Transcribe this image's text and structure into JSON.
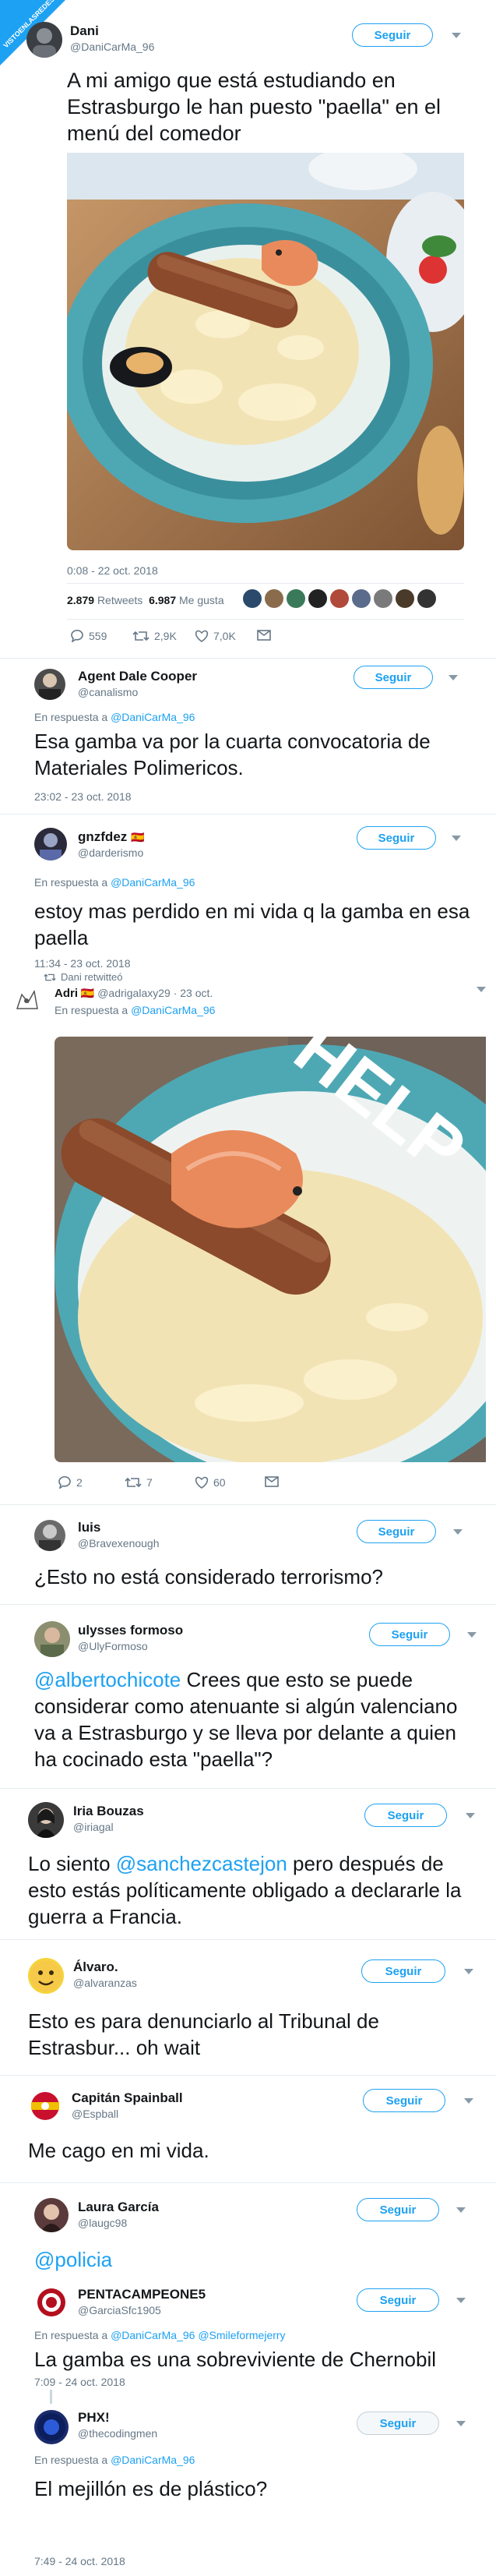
{
  "watermark": "VISTOENLASREDES.COM",
  "main_tweet": {
    "name": "Dani",
    "handle": "@DaniCarMa_96",
    "follow": "Seguir",
    "text": "A mi amigo que está estudiando en Estrasburgo le han puesto \"paella\" en el menú del comedor",
    "time": "0:08 - 22 oct. 2018",
    "retweets_count": "2.879",
    "retweets_label": "Retweets",
    "likes_count": "6.987",
    "likes_label": "Me gusta",
    "reply_count": "559",
    "rt_count": "2,9K",
    "like_count": "7,0K"
  },
  "replies": [
    {
      "name": "Agent Dale Cooper",
      "handle": "@canalismo",
      "follow": "Seguir",
      "reply_to_prefix": "En respuesta a",
      "reply_to": "@DaniCarMa_96",
      "text": "Esa gamba va por la cuarta convocatoria de Materiales Polimericos.",
      "time": "23:02 - 23 oct. 2018"
    },
    {
      "name": "gnzfdez",
      "flag": "🇪🇸",
      "handle": "@darderismo",
      "follow": "Seguir",
      "reply_to_prefix": "En respuesta a",
      "reply_to": "@DaniCarMa_96",
      "text": "estoy mas perdido en mi vida q la gamba en esa paella",
      "time": "11:34 - 23 oct. 2018"
    }
  ],
  "retweet": {
    "retweeted_by": "Dani retwitteó",
    "name": "Adri",
    "flag": "🇪🇸",
    "handle": "@adrigalaxy29",
    "date": "· 23 oct.",
    "reply_to_prefix": "En respuesta a",
    "reply_to": "@DaniCarMa_96",
    "image_text": "HELP",
    "reply_count": "2",
    "rt_count": "7",
    "like_count": "60"
  },
  "replies2": [
    {
      "name": "luis",
      "handle": "@Bravexenough",
      "follow": "Seguir",
      "text": "¿Esto no está considerado terrorismo?"
    },
    {
      "name": "ulysses formoso",
      "handle": "@UlyFormoso",
      "follow": "Seguir",
      "mention": "@albertochicote",
      "text": " Crees que esto se puede considerar como atenuante si algún valenciano va a Estrasburgo y se lleva por delante a quien ha cocinado esta \"paella\"?"
    },
    {
      "name": "Iria Bouzas",
      "handle": "@iriagal",
      "follow": "Seguir",
      "text_a": "Lo siento ",
      "mention": "@sanchezcastejon",
      "text_b": " pero después de esto estás políticamente obligado a declararle la guerra a Francia."
    },
    {
      "name": "Álvaro.",
      "handle": "@alvaranzas",
      "follow": "Seguir",
      "text": "Esto es para denunciarlo al Tribunal de Estrasbur... oh wait"
    },
    {
      "name": "Capitán Spainball",
      "handle": "@Espball",
      "follow": "Seguir",
      "text": "Me cago en mi vida."
    },
    {
      "name": "Laura García",
      "handle": "@laugc98",
      "follow": "Seguir",
      "mention": "@policia"
    },
    {
      "name": "PENTACAMPEONE5",
      "handle": "@GarciaSfc1905",
      "follow": "Seguir",
      "reply_to_prefix": "En respuesta a",
      "reply_to": "@DaniCarMa_96 @Smileformejerry",
      "text": "La gamba es una sobreviviente de Chernobil",
      "time": "7:09 - 24 oct. 2018"
    },
    {
      "name": "PHX!",
      "handle": "@thecodingmen",
      "follow": "Seguir",
      "reply_to_prefix": "En respuesta a",
      "reply_to": "@DaniCarMa_96",
      "text": "El mejillón es de plástico?",
      "time": "7:49 - 24 oct. 2018"
    }
  ],
  "colors": {
    "accent": "#1da1f2",
    "muted": "#657786",
    "plate": "#4ea8b4",
    "sausage": "#8a4a2b",
    "rice": "#f2e3b5",
    "shrimp": "#e98a5c"
  },
  "icons": [
    "reply-icon",
    "retweet-icon",
    "heart-icon",
    "mail-icon",
    "chevron-down-icon"
  ]
}
